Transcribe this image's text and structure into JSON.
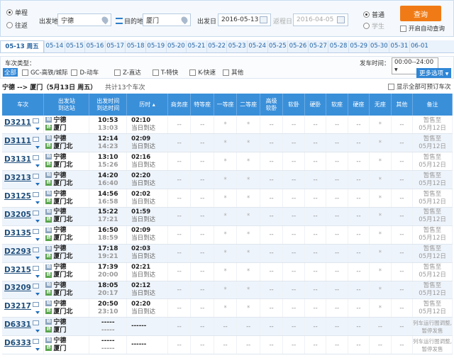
{
  "search": {
    "trip_types": [
      "单程",
      "往返"
    ],
    "from_label": "出发地",
    "from_value": "宁德",
    "to_label": "目的地",
    "to_value": "厦门",
    "depart_label": "出发日",
    "depart_value": "2016-05-13",
    "return_label": "返程日",
    "return_value": "2016-04-05",
    "passenger_types": [
      "普通",
      "学生"
    ],
    "query_label": "查询",
    "auto_query_label": "开启自动查询"
  },
  "dates": {
    "active": "05-13 周五",
    "items": [
      "05-14",
      "05-15",
      "05-16",
      "05-17",
      "05-18",
      "05-19",
      "05-20",
      "05-21",
      "05-22",
      "05-23",
      "05-24",
      "05-25",
      "05-26",
      "05-27",
      "05-28",
      "05-29",
      "05-30",
      "05-31",
      "06-01"
    ]
  },
  "filters": {
    "type_label": "车次类型：",
    "all_label": "全部",
    "types": [
      "GC-高铁/城际",
      "D-动车",
      "Z-直达",
      "T-特快",
      "K-快速",
      "其他"
    ],
    "depart_time_label": "发车时间：",
    "depart_time_value": "00:00--24:00",
    "more_label": "更多选项"
  },
  "summary": {
    "route": "宁德 --> 厦门（5月13日  周五）",
    "count": "共计13个车次",
    "show_all": "显示全部可预订车次"
  },
  "table": {
    "headers": {
      "train": "车次",
      "station": [
        "出发站",
        "到达站"
      ],
      "time": [
        "出发时间",
        "到达时间"
      ],
      "duration": "历时",
      "seats": [
        "商务座",
        "特等座",
        "一等座",
        "二等座",
        "高级\n软卧",
        "软卧",
        "硬卧",
        "软座",
        "硬座",
        "无座",
        "其他"
      ],
      "note": "备注"
    },
    "rows": [
      {
        "train": "D3211",
        "from": "宁德",
        "to": "厦门",
        "dep": "10:53",
        "arr": "13:03",
        "dur": "02:10",
        "arrive_day": "当日到达",
        "seats": [
          "--",
          "--",
          "*",
          "*",
          "--",
          "--",
          "--",
          "--",
          "--",
          "*",
          "--"
        ],
        "note": [
          "暂售至",
          "05月12日"
        ]
      },
      {
        "train": "D3111",
        "from": "宁德",
        "to": "厦门北",
        "dep": "12:14",
        "arr": "14:23",
        "dur": "02:09",
        "arrive_day": "当日到达",
        "seats": [
          "--",
          "--",
          "*",
          "*",
          "--",
          "--",
          "--",
          "--",
          "--",
          "*",
          "--"
        ],
        "note": [
          "暂售至",
          "05月12日"
        ]
      },
      {
        "train": "D3131",
        "from": "宁德",
        "to": "厦门北",
        "dep": "13:10",
        "arr": "15:26",
        "dur": "02:16",
        "arrive_day": "当日到达",
        "seats": [
          "--",
          "--",
          "*",
          "*",
          "--",
          "--",
          "--",
          "--",
          "--",
          "*",
          "--"
        ],
        "note": [
          "暂售至",
          "05月12日"
        ]
      },
      {
        "train": "D3213",
        "from": "宁德",
        "to": "厦门北",
        "dep": "14:20",
        "arr": "16:40",
        "dur": "02:20",
        "arrive_day": "当日到达",
        "seats": [
          "--",
          "--",
          "*",
          "*",
          "--",
          "--",
          "--",
          "--",
          "--",
          "*",
          "--"
        ],
        "note": [
          "暂售至",
          "05月12日"
        ]
      },
      {
        "train": "D3125",
        "from": "宁德",
        "to": "厦门北",
        "dep": "14:56",
        "arr": "16:58",
        "dur": "02:02",
        "arrive_day": "当日到达",
        "seats": [
          "--",
          "--",
          "*",
          "*",
          "--",
          "--",
          "--",
          "--",
          "--",
          "*",
          "--"
        ],
        "note": [
          "暂售至",
          "05月12日"
        ]
      },
      {
        "train": "D3205",
        "from": "宁德",
        "to": "厦门北",
        "dep": "15:22",
        "arr": "17:21",
        "dur": "01:59",
        "arrive_day": "当日到达",
        "seats": [
          "--",
          "--",
          "*",
          "*",
          "--",
          "--",
          "--",
          "--",
          "--",
          "*",
          "--"
        ],
        "note": [
          "暂售至",
          "05月12日"
        ]
      },
      {
        "train": "D3135",
        "from": "宁德",
        "to": "厦门北",
        "dep": "16:50",
        "arr": "18:59",
        "dur": "02:09",
        "arrive_day": "当日到达",
        "seats": [
          "--",
          "--",
          "*",
          "*",
          "--",
          "--",
          "--",
          "--",
          "--",
          "*",
          "--"
        ],
        "note": [
          "暂售至",
          "05月12日"
        ]
      },
      {
        "train": "D2293",
        "from": "宁德",
        "to": "厦门北",
        "dep": "17:18",
        "arr": "19:21",
        "dur": "02:03",
        "arrive_day": "当日到达",
        "seats": [
          "--",
          "--",
          "*",
          "*",
          "--",
          "--",
          "--",
          "--",
          "--",
          "*",
          "--"
        ],
        "note": [
          "暂售至",
          "05月12日"
        ]
      },
      {
        "train": "D3215",
        "from": "宁德",
        "to": "厦门北",
        "dep": "17:39",
        "arr": "20:00",
        "dur": "02:21",
        "arrive_day": "当日到达",
        "seats": [
          "--",
          "--",
          "*",
          "*",
          "--",
          "--",
          "--",
          "--",
          "--",
          "*",
          "--"
        ],
        "note": [
          "暂售至",
          "05月12日"
        ]
      },
      {
        "train": "D3209",
        "from": "宁德",
        "to": "厦门北",
        "dep": "18:05",
        "arr": "20:17",
        "dur": "02:12",
        "arrive_day": "当日到达",
        "seats": [
          "--",
          "--",
          "*",
          "*",
          "--",
          "--",
          "--",
          "--",
          "--",
          "*",
          "--"
        ],
        "note": [
          "暂售至",
          "05月12日"
        ]
      },
      {
        "train": "D3217",
        "from": "宁德",
        "to": "厦门北",
        "dep": "20:50",
        "arr": "23:10",
        "dur": "02:20",
        "arrive_day": "当日到达",
        "seats": [
          "--",
          "--",
          "*",
          "*",
          "--",
          "--",
          "--",
          "--",
          "--",
          "*",
          "--"
        ],
        "note": [
          "暂售至",
          "05月12日"
        ]
      },
      {
        "train": "D6331",
        "from": "宁德",
        "to": "厦门",
        "dep": "-----",
        "arr": "-----",
        "dur": "------",
        "arrive_day": "",
        "seats": [
          "--",
          "--",
          "--",
          "--",
          "--",
          "--",
          "--",
          "--",
          "--",
          "--",
          "--"
        ],
        "note": [
          "列车运行图调整,",
          "暂停发售"
        ]
      },
      {
        "train": "D6333",
        "from": "宁德",
        "to": "厦门",
        "dep": "-----",
        "arr": "-----",
        "dur": "------",
        "arrive_day": "",
        "seats": [
          "--",
          "--",
          "--",
          "--",
          "--",
          "--",
          "--",
          "--",
          "--",
          "--",
          "--"
        ],
        "note": [
          "列车运行图调整,",
          "暂停发售"
        ]
      }
    ]
  }
}
